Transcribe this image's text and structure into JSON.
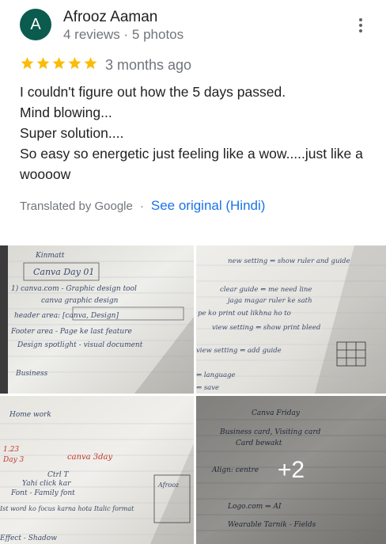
{
  "author": {
    "initial": "A",
    "name": "Afrooz Aaman",
    "meta": "4 reviews · 5 photos",
    "avatar_color": "#0b5b4e"
  },
  "rating": {
    "stars": 5,
    "max": 5,
    "star_color": "#fbbc04"
  },
  "date": "3 months ago",
  "review_lines": [
    "I couldn't figure out how the 5 days passed.",
    "Mind blowing...",
    "Super solution....",
    "So easy so energetic just feeling like a wow.....just like a",
    "woooow"
  ],
  "translation": {
    "label": "Translated by Google",
    "separator": "·",
    "link": "See original (Hindi)",
    "link_color": "#1a73e8"
  },
  "more_icon": "more-vert-icon",
  "photos": {
    "more_count_label": "+2",
    "photo1": {
      "lines": [
        "Kinmatt",
        "Canva Day 01",
        "1) canva.com - Graphic design tool",
        "canva graphic design",
        "header area: [canva, Design]",
        "Footer area - Page ke last feature",
        "Design spotlight - visual document",
        "Business"
      ]
    },
    "photo2": {
      "lines": [
        "new setting ⇐ show ruler and guide",
        "clear guide ⇐ me need line",
        "jaga magar ruler ke sath",
        "pe ko print out likhna ho to",
        "view setting ⇐ show print bleed",
        "view setting ⇐ add guide",
        "⇐ language",
        "⇐ save"
      ]
    },
    "photo3": {
      "lines": [
        "Home work",
        "1.23",
        "Day 3",
        "canva 3day",
        "Ctrl T",
        "Yahi click kar",
        "Font - Family font",
        "Ist word ko focus karna hota Italic format",
        "Afrooz",
        "Effect - Shadow"
      ]
    },
    "photo4": {
      "lines": [
        "Canva Friday",
        "Business card, Visiting card",
        "Card bewakt",
        "Align: centre",
        "Logo.com ⇐ AI",
        "Wearable Tarnik - Fields"
      ]
    }
  }
}
